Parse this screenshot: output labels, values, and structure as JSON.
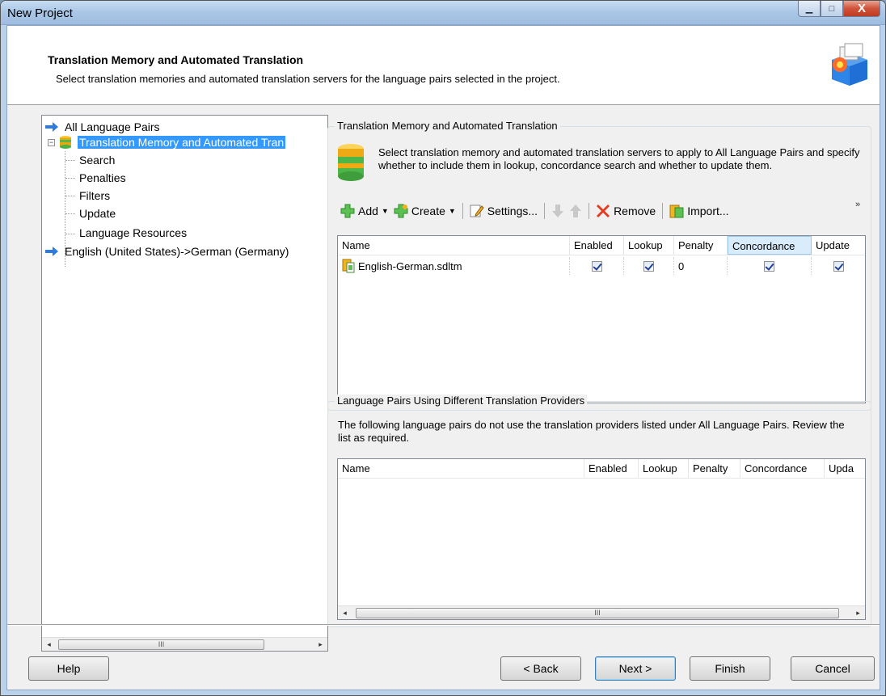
{
  "window": {
    "title": "New Project",
    "minimize": "▁",
    "maximize": "□",
    "close": "X"
  },
  "header": {
    "title": "Translation Memory and Automated Translation",
    "subtitle": "Select translation memories and automated translation servers for the language pairs selected in the project."
  },
  "tree": {
    "items": [
      {
        "label": "All Language Pairs"
      },
      {
        "label": "Translation Memory and Automated Tran"
      },
      {
        "label": "Search"
      },
      {
        "label": "Penalties"
      },
      {
        "label": "Filters"
      },
      {
        "label": "Update"
      },
      {
        "label": "Language Resources"
      },
      {
        "label": "English (United States)->German (Germany)"
      }
    ],
    "expander": "−"
  },
  "tm_group": {
    "title": "Translation Memory and Automated Translation",
    "description": "Select translation memory and automated translation servers to apply to All Language Pairs and specify whether to include them in lookup, concordance search and whether to update them.",
    "toolbar": {
      "add": "Add",
      "create": "Create",
      "settings": "Settings...",
      "remove": "Remove",
      "import": "Import...",
      "more": "»"
    },
    "columns": [
      "Name",
      "Enabled",
      "Lookup",
      "Penalty",
      "Concordance",
      "Update"
    ],
    "rows": [
      {
        "name": "English-German.sdltm",
        "enabled": true,
        "lookup": true,
        "penalty": "0",
        "concordance": true,
        "update": true
      }
    ]
  },
  "lp_group": {
    "title": "Language Pairs Using Different Translation Providers",
    "description": "The following language pairs do not use the translation providers listed under All Language Pairs. Review the list as required.",
    "columns": [
      "Name",
      "Enabled",
      "Lookup",
      "Penalty",
      "Concordance",
      "Upda"
    ]
  },
  "scroll": {
    "thumb_grip": "III",
    "left": "◂",
    "right": "▸"
  },
  "buttons": {
    "help": "Help",
    "back": "< Back",
    "next": "Next >",
    "finish": "Finish",
    "cancel": "Cancel"
  }
}
